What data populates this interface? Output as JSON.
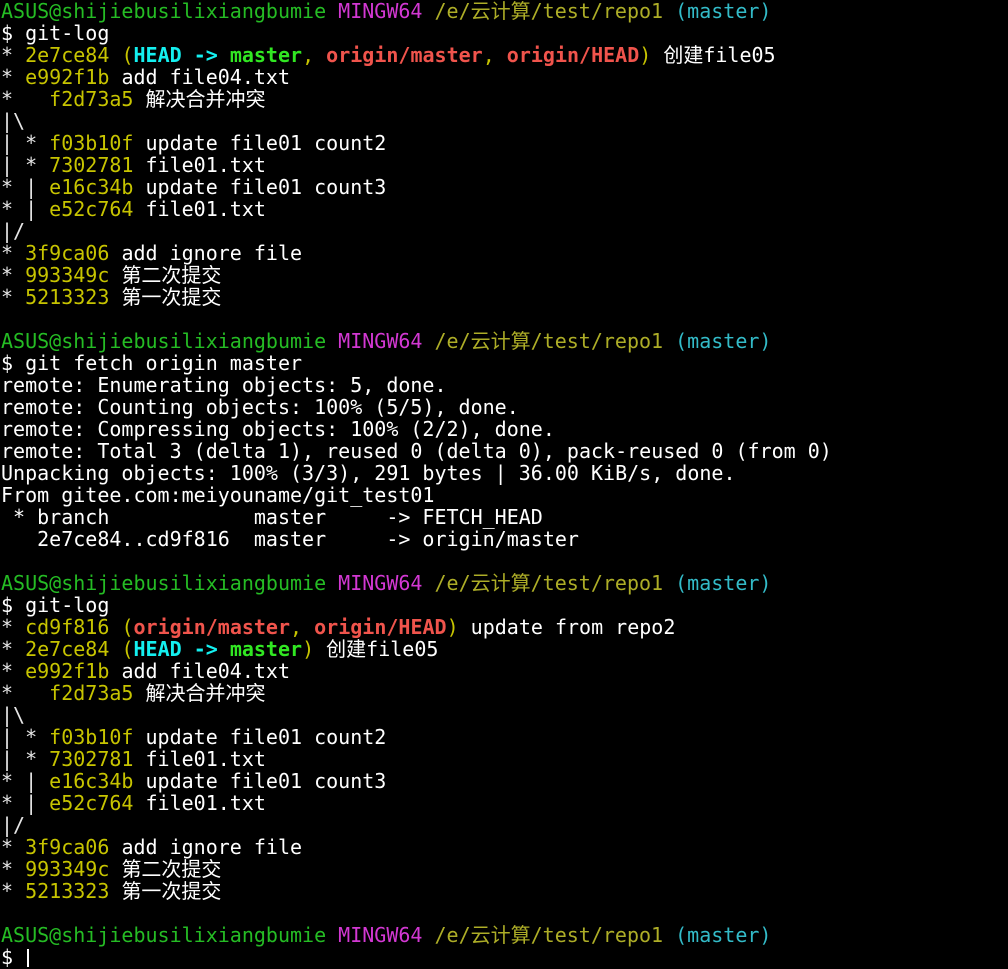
{
  "prompt": {
    "user_host": "ASUS@shijiebusilixiangbumie",
    "system": "MINGW64",
    "path": "/e/云计算/test/repo1",
    "branch": "(master)",
    "symbol": "$"
  },
  "blocks": [
    {
      "command": "git-log",
      "log": [
        {
          "graph": "* ",
          "sha": "2e7ce84",
          "refs": [
            {
              "text": "HEAD -> ",
              "style": "cyan"
            },
            {
              "text": "master",
              "style": "green"
            },
            {
              "text": ", ",
              "style": "yellow"
            },
            {
              "text": "origin/master",
              "style": "red"
            },
            {
              "text": ", ",
              "style": "yellow"
            },
            {
              "text": "origin/HEAD",
              "style": "red"
            }
          ],
          "msg": "创建file05"
        },
        {
          "graph": "* ",
          "sha": "e992f1b",
          "refs": [],
          "msg": "add file04.txt"
        },
        {
          "graph": "*   ",
          "sha": "f2d73a5",
          "refs": [],
          "msg": "解决合并冲突"
        },
        {
          "graph": "|\\",
          "sha": "",
          "refs": [],
          "msg": ""
        },
        {
          "graph": "| * ",
          "sha": "f03b10f",
          "refs": [],
          "msg": "update file01 count2"
        },
        {
          "graph": "| * ",
          "sha": "7302781",
          "refs": [],
          "msg": "file01.txt"
        },
        {
          "graph": "* | ",
          "sha": "e16c34b",
          "refs": [],
          "msg": "update file01 count3"
        },
        {
          "graph": "* | ",
          "sha": "e52c764",
          "refs": [],
          "msg": "file01.txt"
        },
        {
          "graph": "|/",
          "sha": "",
          "refs": [],
          "msg": ""
        },
        {
          "graph": "* ",
          "sha": "3f9ca06",
          "refs": [],
          "msg": "add ignore file"
        },
        {
          "graph": "* ",
          "sha": "993349c",
          "refs": [],
          "msg": "第二次提交"
        },
        {
          "graph": "* ",
          "sha": "5213323",
          "refs": [],
          "msg": "第一次提交"
        }
      ]
    },
    {
      "command": "git fetch origin master",
      "output": [
        "remote: Enumerating objects: 5, done.",
        "remote: Counting objects: 100% (5/5), done.",
        "remote: Compressing objects: 100% (2/2), done.",
        "remote: Total 3 (delta 1), reused 0 (delta 0), pack-reused 0 (from 0)",
        "Unpacking objects: 100% (3/3), 291 bytes | 36.00 KiB/s, done.",
        "From gitee.com:meiyouname/git_test01",
        " * branch            master     -> FETCH_HEAD",
        "   2e7ce84..cd9f816  master     -> origin/master"
      ]
    },
    {
      "command": "git-log",
      "log": [
        {
          "graph": "* ",
          "sha": "cd9f816",
          "refs": [
            {
              "text": "origin/master",
              "style": "red"
            },
            {
              "text": ", ",
              "style": "yellow"
            },
            {
              "text": "origin/HEAD",
              "style": "red"
            }
          ],
          "msg": "update from repo2"
        },
        {
          "graph": "* ",
          "sha": "2e7ce84",
          "refs": [
            {
              "text": "HEAD -> ",
              "style": "cyan"
            },
            {
              "text": "master",
              "style": "green"
            }
          ],
          "msg": "创建file05"
        },
        {
          "graph": "* ",
          "sha": "e992f1b",
          "refs": [],
          "msg": "add file04.txt"
        },
        {
          "graph": "*   ",
          "sha": "f2d73a5",
          "refs": [],
          "msg": "解决合并冲突"
        },
        {
          "graph": "|\\",
          "sha": "",
          "refs": [],
          "msg": ""
        },
        {
          "graph": "| * ",
          "sha": "f03b10f",
          "refs": [],
          "msg": "update file01 count2"
        },
        {
          "graph": "| * ",
          "sha": "7302781",
          "refs": [],
          "msg": "file01.txt"
        },
        {
          "graph": "* | ",
          "sha": "e16c34b",
          "refs": [],
          "msg": "update file01 count3"
        },
        {
          "graph": "* | ",
          "sha": "e52c764",
          "refs": [],
          "msg": "file01.txt"
        },
        {
          "graph": "|/",
          "sha": "",
          "refs": [],
          "msg": ""
        },
        {
          "graph": "* ",
          "sha": "3f9ca06",
          "refs": [],
          "msg": "add ignore file"
        },
        {
          "graph": "* ",
          "sha": "993349c",
          "refs": [],
          "msg": "第二次提交"
        },
        {
          "graph": "* ",
          "sha": "5213323",
          "refs": [],
          "msg": "第一次提交"
        }
      ]
    }
  ],
  "final_prompt_input": "",
  "colors": {
    "user_host": "#25bc24",
    "system": "#d338d3",
    "path": "#adad27",
    "branch": "#33bbc8",
    "sha": "#c7c400",
    "head": "#14f0f0",
    "local_branch": "#31e722",
    "remote_ref": "#f0544c",
    "background": "#000000",
    "text": "#ffffff"
  }
}
